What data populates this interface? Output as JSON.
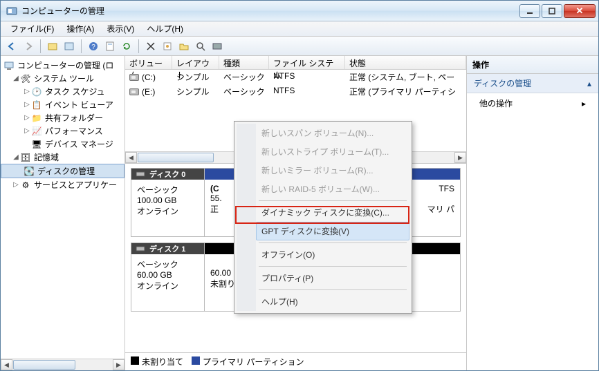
{
  "window": {
    "title": "コンピューターの管理"
  },
  "menu": {
    "file": "ファイル(F)",
    "action": "操作(A)",
    "view": "表示(V)",
    "help": "ヘルプ(H)"
  },
  "tree": {
    "root": "コンピューターの管理 (ロ",
    "system_tools": "システム ツール",
    "task_scheduler": "タスク スケジュ",
    "event_viewer": "イベント ビューア",
    "shared_folders": "共有フォルダー",
    "performance": "パフォーマンス",
    "device_manager": "デバイス マネージ",
    "storage": "記憶域",
    "disk_mgmt": "ディスクの管理",
    "services": "サービスとアプリケー"
  },
  "columns": {
    "volume": "ボリューム",
    "layout": "レイアウト",
    "type": "種類",
    "fs": "ファイル システム",
    "status": "状態"
  },
  "volumes": [
    {
      "name": "(C:)",
      "layout": "シンプル",
      "type": "ベーシック",
      "fs": "NTFS",
      "status": "正常 (システム, ブート, ペー"
    },
    {
      "name": "(E:)",
      "layout": "シンプル",
      "type": "ベーシック",
      "fs": "NTFS",
      "status": "正常 (プライマリ パーティシ"
    }
  ],
  "disks": [
    {
      "title": "ディスク 0",
      "kind": "ベーシック",
      "size": "100.00 GB",
      "state": "オンライン",
      "part0_name": "(C",
      "part0_size": "55.",
      "part0_status": "正",
      "part1_fs": "TFS",
      "part1_status": "マリ パ"
    },
    {
      "title": "ディスク 1",
      "kind": "ベーシック",
      "size": "60.00 GB",
      "state": "オンライン",
      "part0_size": "60.00 GB",
      "part0_status": "未割り当て"
    }
  ],
  "legend": {
    "unallocated": "未割り当て",
    "primary": "プライマリ パーティション"
  },
  "actions": {
    "header": "操作",
    "disk_mgmt": "ディスクの管理",
    "other": "他の操作"
  },
  "context_menu": {
    "span": "新しいスパン ボリューム(N)...",
    "stripe": "新しいストライプ ボリューム(T)...",
    "mirror": "新しいミラー ボリューム(R)...",
    "raid5": "新しい RAID-5 ボリューム(W)...",
    "dynamic": "ダイナミック ディスクに変換(C)...",
    "gpt": "GPT ディスクに変換(V)",
    "offline": "オフライン(O)",
    "properties": "プロパティ(P)",
    "help": "ヘルプ(H)"
  }
}
